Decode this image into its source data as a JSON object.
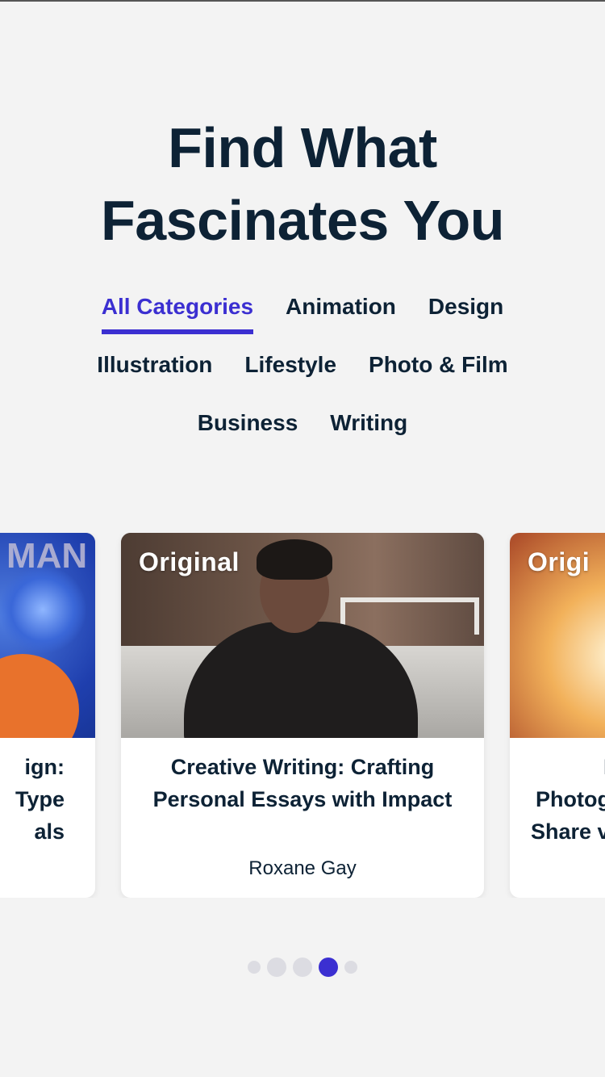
{
  "hero": {
    "title_line1": "Find What",
    "title_line2": "Fascinates You"
  },
  "categories": {
    "items": [
      {
        "label": "All Categories",
        "active": true
      },
      {
        "label": "Animation",
        "active": false
      },
      {
        "label": "Design",
        "active": false
      },
      {
        "label": "Illustration",
        "active": false
      },
      {
        "label": "Lifestyle",
        "active": false
      },
      {
        "label": "Photo & Film",
        "active": false
      },
      {
        "label": "Business",
        "active": false
      },
      {
        "label": "Writing",
        "active": false
      }
    ]
  },
  "carousel": {
    "cards": [
      {
        "badge": "",
        "image_text": "MAN",
        "title_lines": [
          "ign:",
          "Type",
          "als"
        ],
        "author": ""
      },
      {
        "badge": "Original",
        "title": "Creative Writing: Crafting Personal Essays with Impact",
        "author": "Roxane Gay"
      },
      {
        "badge": "Origi",
        "title_lines": [
          "In",
          "Photog",
          "Share v"
        ],
        "author": ""
      }
    ],
    "pager": {
      "count": 5,
      "active_index": 3
    }
  },
  "colors": {
    "accent": "#3b2fd1",
    "text": "#0d2235",
    "background": "#f3f3f3"
  }
}
